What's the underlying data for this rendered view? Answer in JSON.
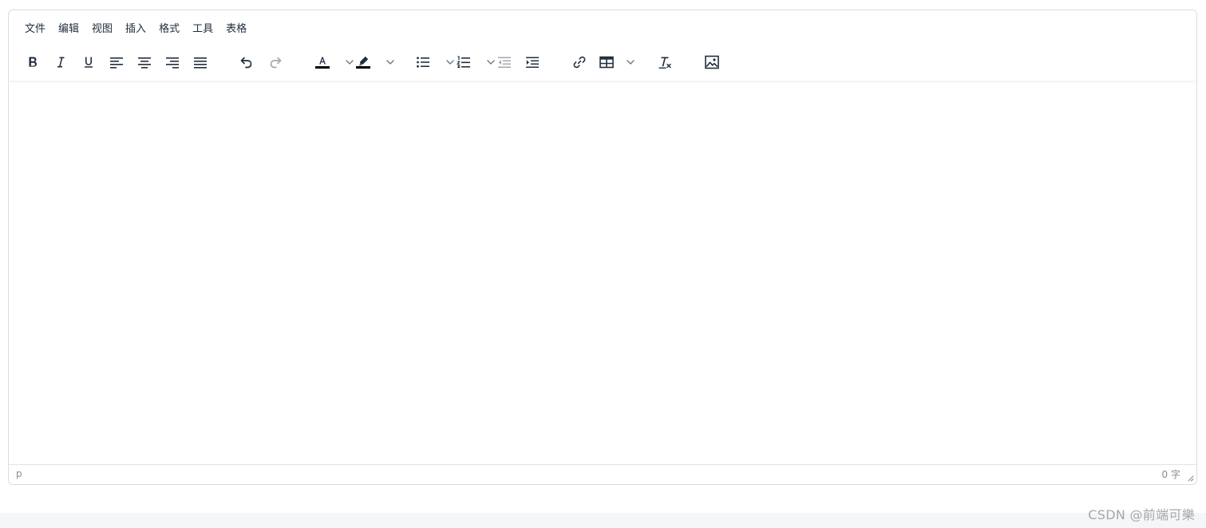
{
  "menubar": {
    "items": [
      "文件",
      "编辑",
      "视图",
      "插入",
      "格式",
      "工具",
      "表格"
    ]
  },
  "toolbar": {
    "buttons": [
      {
        "name": "bold-button",
        "icon": "bold-icon"
      },
      {
        "name": "italic-button",
        "icon": "italic-icon"
      },
      {
        "name": "underline-button",
        "icon": "underline-icon"
      },
      {
        "name": "align-left-button",
        "icon": "align-left-icon"
      },
      {
        "name": "align-center-button",
        "icon": "align-center-icon"
      },
      {
        "name": "align-right-button",
        "icon": "align-right-icon"
      },
      {
        "name": "align-justify-button",
        "icon": "align-justify-icon"
      },
      {
        "name": "undo-button",
        "icon": "undo-icon"
      },
      {
        "name": "redo-button",
        "icon": "redo-icon",
        "disabled": true
      },
      {
        "name": "text-color-button",
        "icon": "text-color-icon",
        "dropdown": true
      },
      {
        "name": "highlight-color-button",
        "icon": "highlight-icon",
        "dropdown": true
      },
      {
        "name": "bullet-list-button",
        "icon": "bullet-list-icon",
        "dropdown": true
      },
      {
        "name": "numbered-list-button",
        "icon": "numbered-list-icon",
        "dropdown": true
      },
      {
        "name": "outdent-button",
        "icon": "outdent-icon",
        "disabled": true
      },
      {
        "name": "indent-button",
        "icon": "indent-icon"
      },
      {
        "name": "link-button",
        "icon": "link-icon"
      },
      {
        "name": "table-button",
        "icon": "table-icon",
        "dropdown": true
      },
      {
        "name": "clear-format-button",
        "icon": "clear-format-icon"
      },
      {
        "name": "image-button",
        "icon": "image-icon"
      }
    ]
  },
  "statusbar": {
    "path": "p",
    "word_count": "0 字"
  },
  "watermark": "CSDN @前端可樂",
  "colors": {
    "icon": "#222f3e",
    "disabled": "#a3a8b0",
    "border": "#dcdcdc",
    "status_text": "#8b8b8b",
    "text_color_swatch": "#000000",
    "highlight_swatch": "#000000"
  }
}
